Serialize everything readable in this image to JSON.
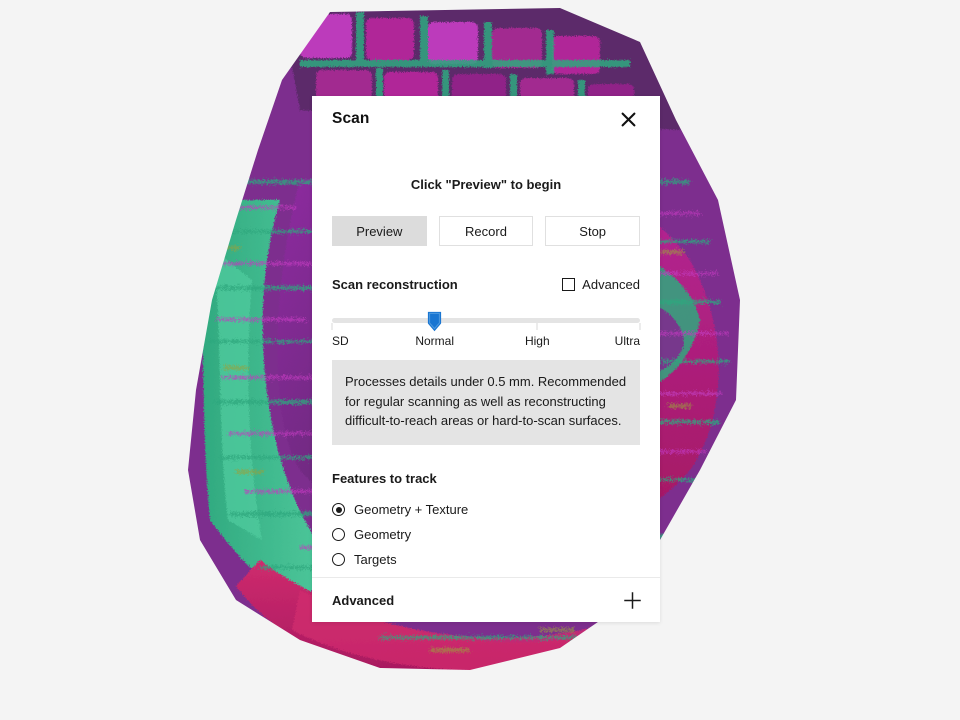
{
  "app": {
    "background_color": "#f4f4f4"
  },
  "viewport": {
    "name": "3d-scan-model-viewport",
    "model_colors": [
      "#2fa87e",
      "#4fc99c",
      "#7d2f8e",
      "#b5279b",
      "#a5175f",
      "#c0185f",
      "#d02c6e",
      "#5b2a6b",
      "#8e2aa0",
      "#6d3a8c",
      "#9aa03a"
    ]
  },
  "panel": {
    "title": "Scan",
    "close_icon": "close-icon",
    "hint": "Click \"Preview\" to begin",
    "buttons": [
      {
        "label": "Preview",
        "active": true
      },
      {
        "label": "Record",
        "active": false
      },
      {
        "label": "Stop",
        "active": false
      }
    ],
    "reconstruction": {
      "title": "Scan reconstruction",
      "advanced_checkbox": {
        "label": "Advanced",
        "checked": false
      },
      "slider": {
        "value": "Normal",
        "value_index": 1,
        "accent_color": "#1976d2",
        "ticks": [
          "SD",
          "Normal",
          "High",
          "Ultra"
        ]
      },
      "description": "Processes details under 0.5 mm. Recommended for regular scanning as well as reconstructing difficult-to-reach areas or hard-to-scan surfaces."
    },
    "features": {
      "title": "Features to track",
      "options": [
        {
          "label": "Geometry + Texture",
          "selected": true
        },
        {
          "label": "Geometry",
          "selected": false
        },
        {
          "label": "Targets",
          "selected": false
        }
      ]
    },
    "footer": {
      "title": "Advanced",
      "expand_icon": "plus-icon"
    }
  }
}
